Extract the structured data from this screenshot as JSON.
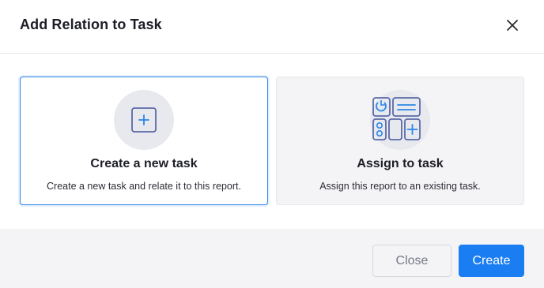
{
  "dialog": {
    "title": "Add Relation to Task",
    "close_icon": "close-icon"
  },
  "options": [
    {
      "title": "Create a new task",
      "description": "Create a new task and relate it to this report.",
      "icon": "add-square-icon",
      "selected": true
    },
    {
      "title": "Assign to task",
      "description": "Assign this report to an existing task.",
      "icon": "dashboard-widgets-icon",
      "selected": false
    }
  ],
  "footer": {
    "close_label": "Close",
    "create_label": "Create"
  },
  "colors": {
    "accent": "#1a7ef2",
    "selected_border": "#2b86e8",
    "icon_stroke": "#5a6aa6",
    "icon_blue": "#2b86e8"
  }
}
